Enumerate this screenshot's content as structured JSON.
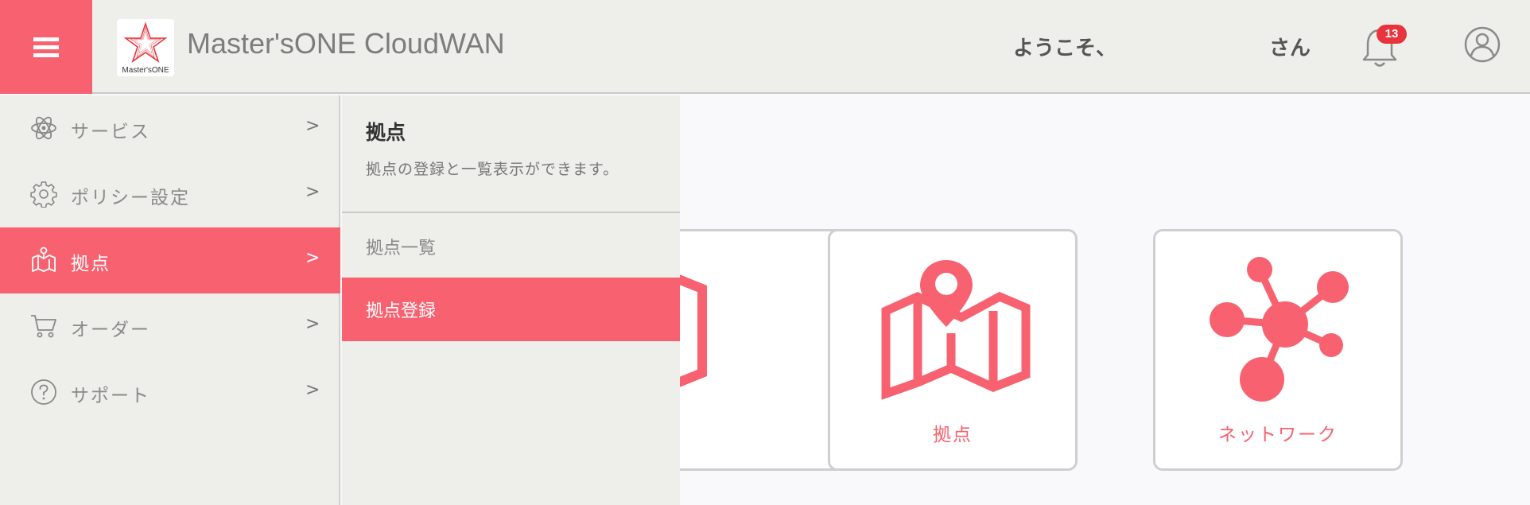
{
  "header": {
    "app_title": "Master'sONE CloudWAN",
    "logo_text": "Master'sONE",
    "welcome": "ようこそ、",
    "san": "さん",
    "notification_count": "13"
  },
  "sidebar": {
    "items": [
      {
        "label": "サービス",
        "chevron": ">",
        "icon": "atom-icon"
      },
      {
        "label": "ポリシー設定",
        "chevron": ">",
        "icon": "gear-icon"
      },
      {
        "label": "拠点",
        "chevron": ">",
        "icon": "map-pin-icon"
      },
      {
        "label": "オーダー",
        "chevron": ">",
        "icon": "cart-icon"
      },
      {
        "label": "サポート",
        "chevron": ">",
        "icon": "help-circle-icon"
      }
    ],
    "active_index": 2
  },
  "subpanel": {
    "title": "拠点",
    "description": "拠点の登録と一覧表示ができます。",
    "items": [
      {
        "label": "拠点一覧"
      },
      {
        "label": "拠点登録"
      }
    ],
    "active_index": 1
  },
  "cards": [
    {
      "label": "拠点",
      "icon": "map-icon"
    },
    {
      "label": "ネットワーク",
      "icon": "network-icon"
    }
  ],
  "colors": {
    "accent": "#f8616f",
    "panel": "#eeeeea",
    "badge": "#e8343c"
  }
}
